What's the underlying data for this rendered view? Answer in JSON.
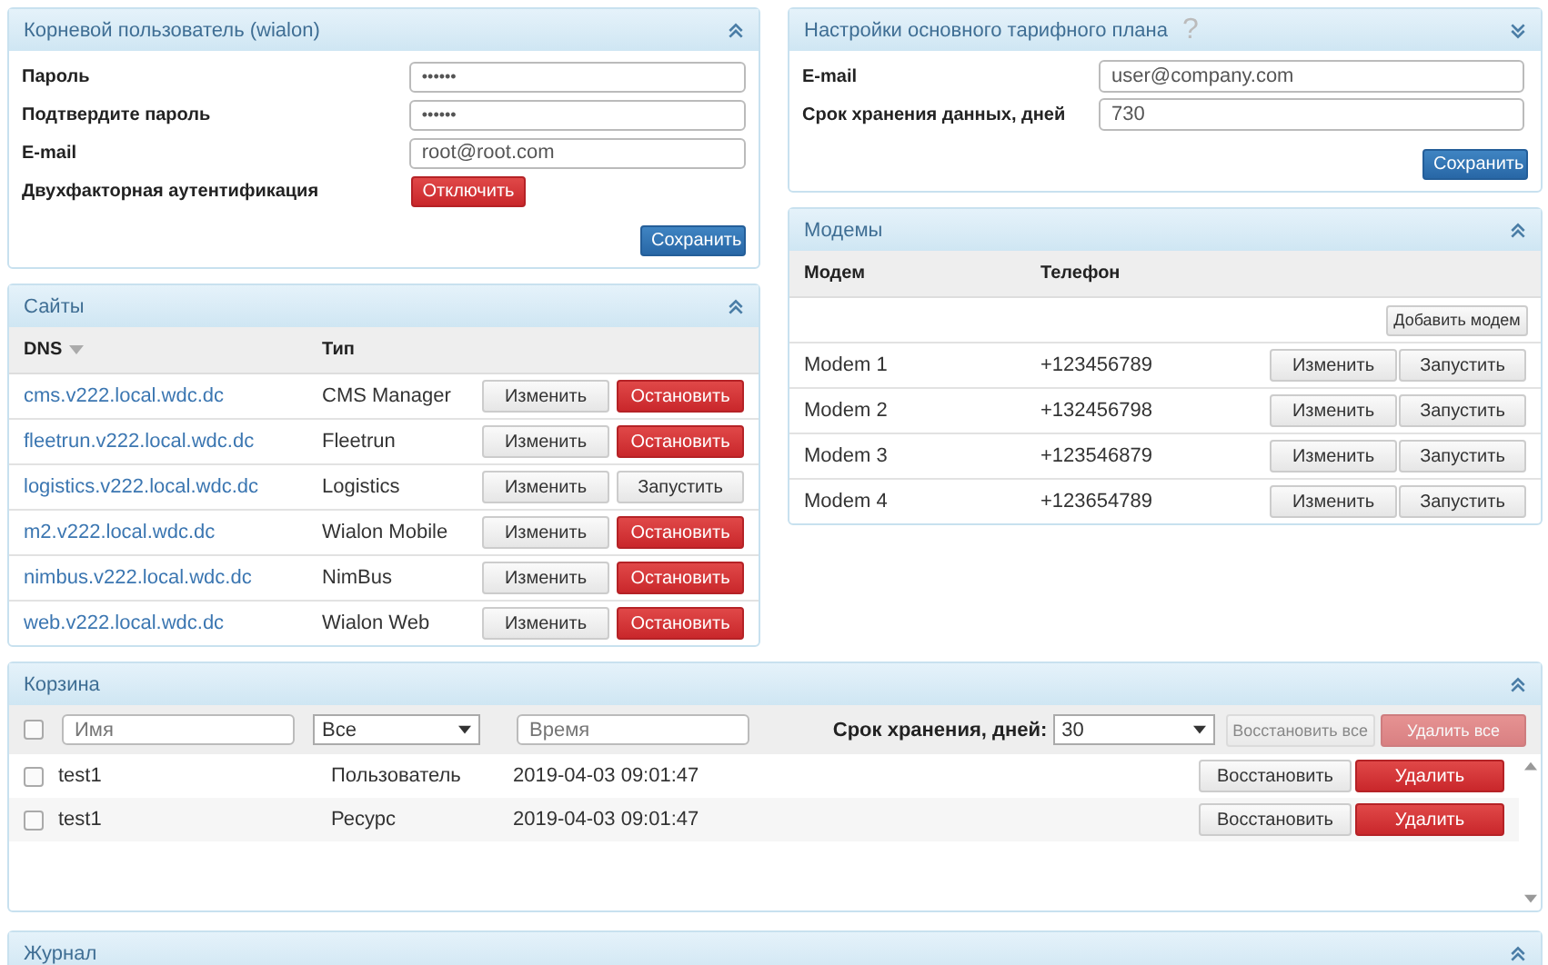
{
  "root_user": {
    "title": "Корневой пользователь (wialon)",
    "expanded": true,
    "fields": [
      {
        "kind": "password",
        "label": "Пароль",
        "value": "••••••"
      },
      {
        "kind": "password",
        "label": "Подтвердите пароль",
        "value": "••••••"
      },
      {
        "kind": "text",
        "label": "E-mail",
        "value": "root@root.com"
      },
      {
        "kind": "button",
        "label": "Двухфакторная аутентификация",
        "button": "Отключить"
      }
    ],
    "save": "Сохранить"
  },
  "tariff": {
    "title": "Настройки основного тарифного плана",
    "help": "?",
    "expanded": false,
    "fields": [
      {
        "kind": "text",
        "label": "E-mail",
        "value": "user@company.com"
      },
      {
        "kind": "text",
        "label": "Срок хранения данных, дней",
        "value": "730"
      }
    ],
    "save": "Сохранить"
  },
  "sites": {
    "title": "Сайты",
    "expanded": true,
    "columns": [
      "DNS",
      "Тип"
    ],
    "rows": [
      {
        "dns": "cms.v222.local.wdc.dc",
        "type": "CMS Manager",
        "edit": "Изменить",
        "action": "Остановить",
        "kind": "stop"
      },
      {
        "dns": "fleetrun.v222.local.wdc.dc",
        "type": "Fleetrun",
        "edit": "Изменить",
        "action": "Остановить",
        "kind": "stop"
      },
      {
        "dns": "logistics.v222.local.wdc.dc",
        "type": "Logistics",
        "edit": "Изменить",
        "action": "Запустить",
        "kind": "start"
      },
      {
        "dns": "m2.v222.local.wdc.dc",
        "type": "Wialon Mobile",
        "edit": "Изменить",
        "action": "Остановить",
        "kind": "stop"
      },
      {
        "dns": "nimbus.v222.local.wdc.dc",
        "type": "NimBus",
        "edit": "Изменить",
        "action": "Остановить",
        "kind": "stop"
      },
      {
        "dns": "web.v222.local.wdc.dc",
        "type": "Wialon Web",
        "edit": "Изменить",
        "action": "Остановить",
        "kind": "stop"
      }
    ]
  },
  "modems": {
    "title": "Модемы",
    "expanded": true,
    "columns": [
      "Модем",
      "Телефон"
    ],
    "add": "Добавить модем",
    "rows": [
      {
        "name": "Modem 1",
        "phone": "+123456789",
        "edit": "Изменить",
        "action": "Запустить",
        "kind": "start"
      },
      {
        "name": "Modem 2",
        "phone": "+132456798",
        "edit": "Изменить",
        "action": "Запустить",
        "kind": "start"
      },
      {
        "name": "Modem 3",
        "phone": "+123546879",
        "edit": "Изменить",
        "action": "Запустить",
        "kind": "start"
      },
      {
        "name": "Modem 4",
        "phone": "+123654789",
        "edit": "Изменить",
        "action": "Запустить",
        "kind": "start"
      }
    ]
  },
  "trash": {
    "title": "Корзина",
    "expanded": true,
    "filters": {
      "all_checked": false,
      "name_placeholder": "Имя",
      "type": "Все",
      "time_placeholder": "Время"
    },
    "retention_label": "Срок хранения, дней:",
    "retention": "30",
    "restore_all": {
      "label": "Восстановить все",
      "disabled": true
    },
    "delete_all": {
      "label": "Удалить все",
      "disabled": true
    },
    "rows": [
      {
        "checked": false,
        "name": "test1",
        "type": "Пользователь",
        "time": "2019-04-03 09:01:47",
        "restore": "Восстановить",
        "delete": "Удалить"
      },
      {
        "checked": false,
        "name": "test1",
        "type": "Ресурс",
        "time": "2019-04-03 09:01:47",
        "restore": "Восстановить",
        "delete": "Удалить"
      }
    ]
  },
  "journal": {
    "title": "Журнал",
    "expanded": true
  }
}
